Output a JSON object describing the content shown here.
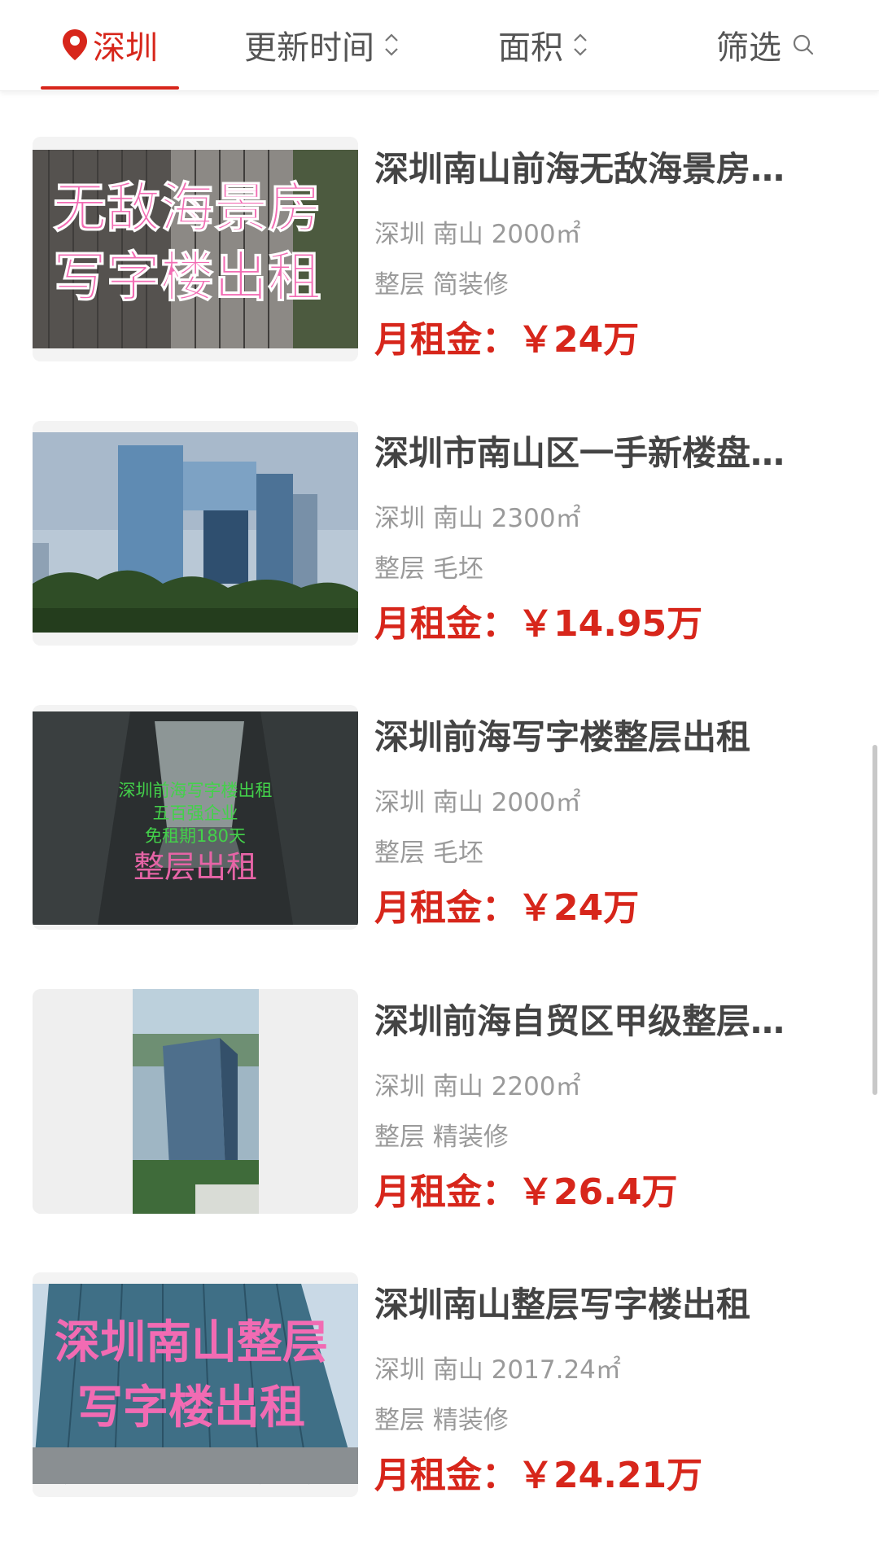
{
  "filter_bar": {
    "city": "深圳",
    "sort_time": "更新时间",
    "sort_area": "面积",
    "filter": "筛选",
    "accent": "#d7261b"
  },
  "listings": [
    {
      "title": "深圳南山前海无敌海景房写字楼出租",
      "location": "深圳 南山 2000㎡",
      "tags": "整层 简装修",
      "price": "月租金：￥24万",
      "thumb_text": [
        "无敌海景房",
        "写字楼出租"
      ]
    },
    {
      "title": "深圳市南山区一手新楼盘整层出租",
      "location": "深圳 南山 2300㎡",
      "tags": "整层 毛坯",
      "price": "月租金：￥14.95万",
      "thumb_text": []
    },
    {
      "title": "深圳前海写字楼整层出租",
      "location": "深圳 南山 2000㎡",
      "tags": "整层 毛坯",
      "price": "月租金：￥24万",
      "thumb_text": [
        "深圳前海写字楼出租",
        "五百强企业",
        "免租期180天",
        "整层出租"
      ]
    },
    {
      "title": "深圳前海自贸区甲级整层写字楼",
      "location": "深圳 南山 2200㎡",
      "tags": "整层 精装修",
      "price": "月租金：￥26.4万",
      "thumb_text": []
    },
    {
      "title": "深圳南山整层写字楼出租",
      "location": "深圳 南山 2017.24㎡",
      "tags": "整层 精装修",
      "price": "月租金：￥24.21万",
      "thumb_text": [
        "深圳南山整层",
        "写字楼出租"
      ]
    }
  ]
}
